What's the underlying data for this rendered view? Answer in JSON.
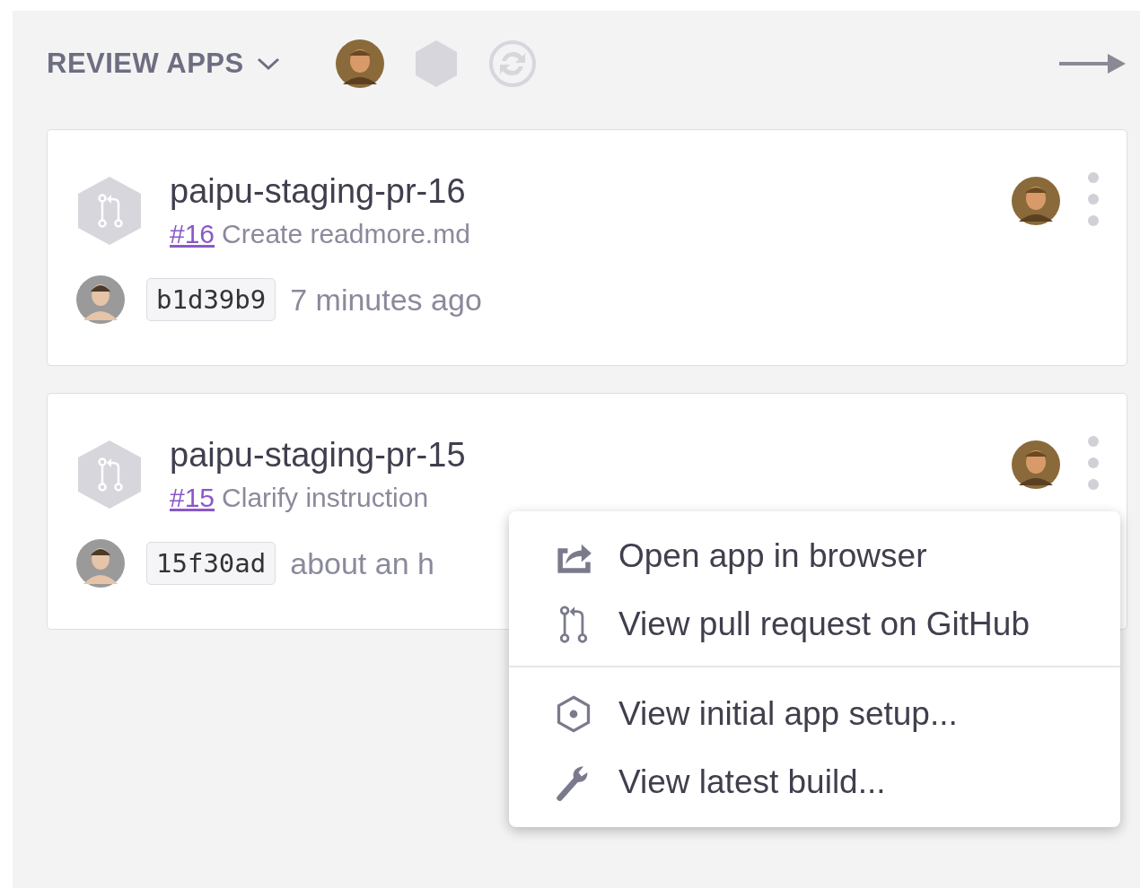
{
  "header": {
    "title": "REVIEW APPS"
  },
  "apps": [
    {
      "name": "paipu-staging-pr-16",
      "pr_number": "#16",
      "pr_title": "Create readmore.md",
      "commit": "b1d39b9",
      "time": "7 minutes ago"
    },
    {
      "name": "paipu-staging-pr-15",
      "pr_number": "#15",
      "pr_title": "Clarify instruction",
      "commit": "15f30ad",
      "time": "about an h"
    }
  ],
  "context_menu": {
    "sections": [
      [
        {
          "kind": "open",
          "label": "Open app in browser"
        },
        {
          "kind": "pull",
          "label": "View pull request on GitHub"
        }
      ],
      [
        {
          "kind": "setup",
          "label": "View initial app setup..."
        },
        {
          "kind": "build",
          "label": "View latest build..."
        }
      ]
    ]
  }
}
